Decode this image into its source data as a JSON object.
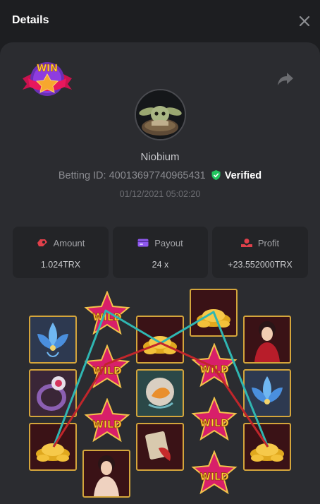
{
  "header": {
    "title": "Details"
  },
  "profile": {
    "username": "Niobium",
    "betting_id_label": "Betting ID: 40013697740965431",
    "verified_label": "Verified",
    "timestamp": "01/12/2021 05:02:20",
    "badge_text": "WIN"
  },
  "stats": {
    "amount": {
      "label": "Amount",
      "value": "1.024TRX"
    },
    "payout": {
      "label": "Payout",
      "value": "24 x"
    },
    "profit": {
      "label": "Profit",
      "value": "+23.552000TRX"
    }
  },
  "reels": {
    "wild_text": "WILD",
    "columns": [
      [
        "lotus",
        "ring",
        "gold"
      ],
      [
        "wild",
        "wild",
        "wild",
        "lady"
      ],
      [
        "gold",
        "koi",
        "scroll"
      ],
      [
        "gold",
        "wild",
        "wild",
        "wild"
      ],
      [
        "lady",
        "lotus",
        "gold"
      ]
    ]
  },
  "colors": {
    "accent_red": "#e0404a",
    "accent_purple": "#8f58f0",
    "verified_green": "#22c55e",
    "win_line_teal": "#2fb6b2",
    "win_line_red": "#c0262b",
    "frame_gold": "#d4a53b"
  }
}
